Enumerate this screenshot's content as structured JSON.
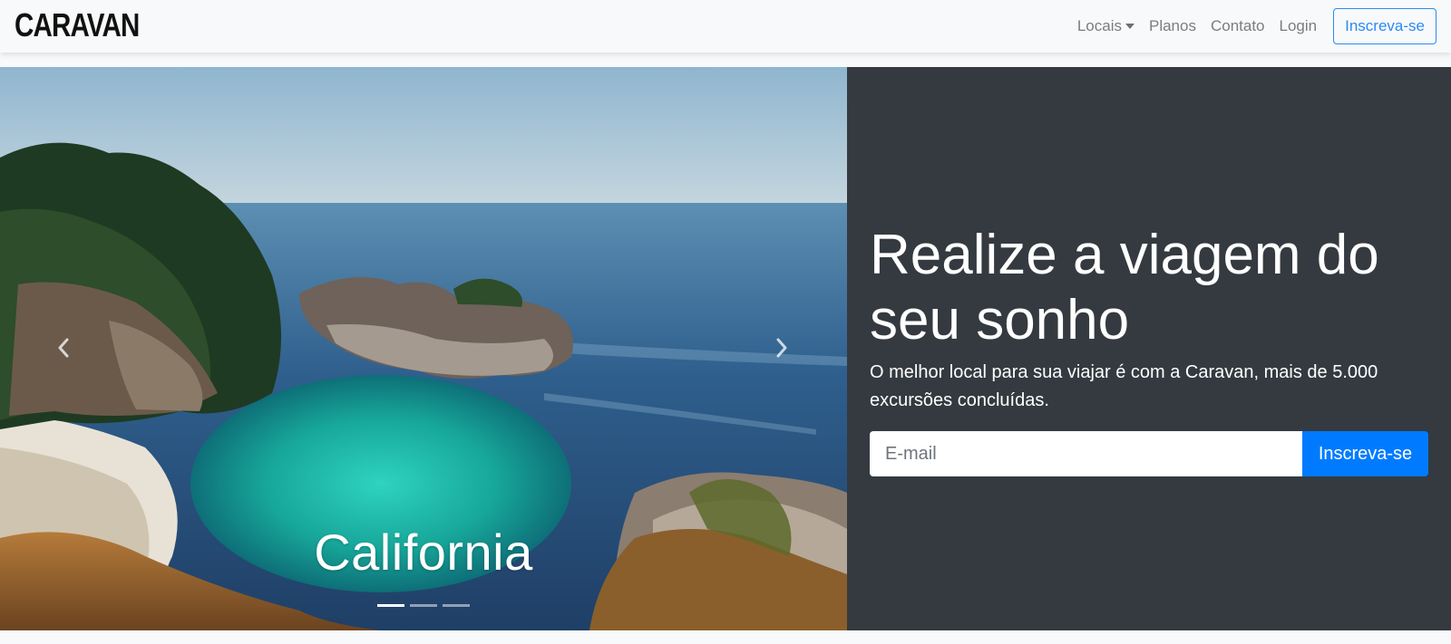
{
  "navbar": {
    "brand": "CARAVAN",
    "links": {
      "locais": "Locais",
      "planos": "Planos",
      "contato": "Contato",
      "login": "Login"
    },
    "cta": "Inscreva-se"
  },
  "carousel": {
    "caption": "California",
    "slide_count": 3,
    "active_slide": 1,
    "prev_icon": "chevron-left-icon",
    "next_icon": "chevron-right-icon"
  },
  "hero": {
    "headline": "Realize a viagem do seu sonho",
    "lead": "O melhor local para sua viajar é com a Caravan, mais de 5.000 excursões concluídas.",
    "email_placeholder": "E-mail",
    "email_value": "",
    "submit_label": "Inscreva-se"
  },
  "colors": {
    "navbar_bg": "#f8f9fa",
    "panel_bg": "#343a40",
    "primary": "#007bff",
    "outline_button": "#2a8bf5",
    "nav_link": "#7a7d80"
  }
}
